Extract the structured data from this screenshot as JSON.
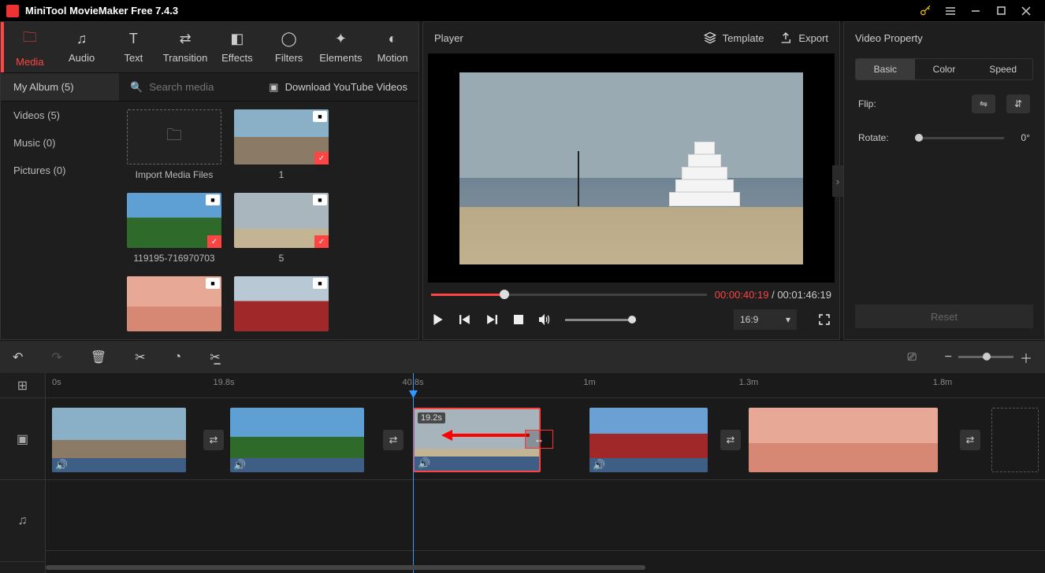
{
  "app": {
    "title": "MiniTool MovieMaker Free 7.4.3"
  },
  "tool_tabs": {
    "media": "Media",
    "audio": "Audio",
    "text": "Text",
    "transition": "Transition",
    "effects": "Effects",
    "filters": "Filters",
    "elements": "Elements",
    "motion": "Motion"
  },
  "album": {
    "my_album": "My Album (5)",
    "search_placeholder": "Search media",
    "yt_label": "Download YouTube Videos",
    "cats": {
      "videos": "Videos (5)",
      "music": "Music (0)",
      "pictures": "Pictures (0)"
    }
  },
  "media": {
    "import_label": "Import Media Files",
    "items": [
      {
        "label": "1"
      },
      {
        "label": "119195-716970703"
      },
      {
        "label": "5"
      }
    ]
  },
  "player": {
    "title": "Player",
    "template": "Template",
    "export": "Export",
    "time_current": "00:00:40:19",
    "time_total": "00:01:46:19",
    "aspect": "16:9"
  },
  "property": {
    "title": "Video Property",
    "tabs": {
      "basic": "Basic",
      "color": "Color",
      "speed": "Speed"
    },
    "flip_label": "Flip:",
    "rotate_label": "Rotate:",
    "rotate_value": "0°",
    "reset": "Reset"
  },
  "ruler": {
    "t0": "0s",
    "t1": "19.8s",
    "t2": "40.8s",
    "t3": "1m",
    "t4": "1.3m",
    "t5": "1.8m"
  },
  "timeline": {
    "sel_duration": "19.2s"
  }
}
